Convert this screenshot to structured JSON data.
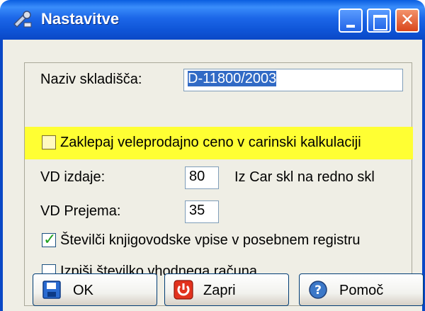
{
  "window": {
    "title": "Nastavitve"
  },
  "form": {
    "warehouse_name_label": "Naziv skladišča:",
    "warehouse_name_value": "D-11800/2003",
    "lock_price_label": "Zaklepaj veleprodajno ceno v carinski kalkulaciji",
    "lock_price_checked": false,
    "vd_issue_label": "VD izdaje:",
    "vd_issue_value": "80",
    "vd_issue_note": "Iz Car skl na redno skl",
    "vd_receipt_label": "VD Prejema:",
    "vd_receipt_value": "35",
    "number_entries_label": "Številči knjigovodske vpise v posebnem registru",
    "number_entries_checked": true,
    "print_invoice_label": "Izpiši številko vhodnega računa",
    "print_invoice_checked": false
  },
  "buttons": {
    "ok": "OK",
    "close": "Zapri",
    "help": "Pomoč"
  },
  "colors": {
    "titlebar": "#0a48c6",
    "highlight": "#ffff33",
    "dialog_bg": "#efeee5",
    "selection": "#316ac5"
  }
}
